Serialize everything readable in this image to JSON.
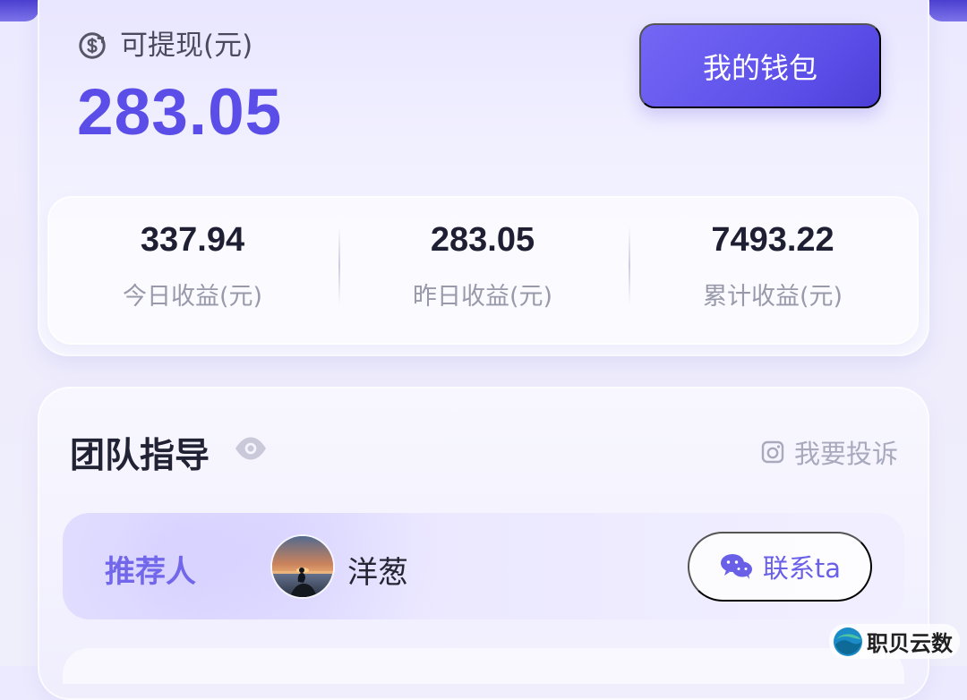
{
  "earnings": {
    "withdrawable_label": "可提现(元)",
    "withdrawable_amount": "283.05",
    "wallet_button_label": "我的钱包",
    "stats": [
      {
        "value": "337.94",
        "label": "今日收益(元)"
      },
      {
        "value": "283.05",
        "label": "昨日收益(元)"
      },
      {
        "value": "7493.22",
        "label": "累计收益(元)"
      }
    ]
  },
  "team": {
    "title": "团队指导",
    "complaint_label": "我要投诉",
    "recommender": {
      "label": "推荐人",
      "name": "洋葱",
      "contact_label": "联系ta"
    }
  },
  "watermark": {
    "text": "职贝云数"
  },
  "colors": {
    "primary": "#5b4ee8",
    "primary_light": "#7467f5",
    "muted_text": "#9899aa",
    "dark_text": "#1f1f33"
  },
  "icons": {
    "withdraw": "money-refresh-icon",
    "eye": "eye-icon",
    "complaint": "camera-complaint-icon",
    "contact": "wechat-icon"
  }
}
